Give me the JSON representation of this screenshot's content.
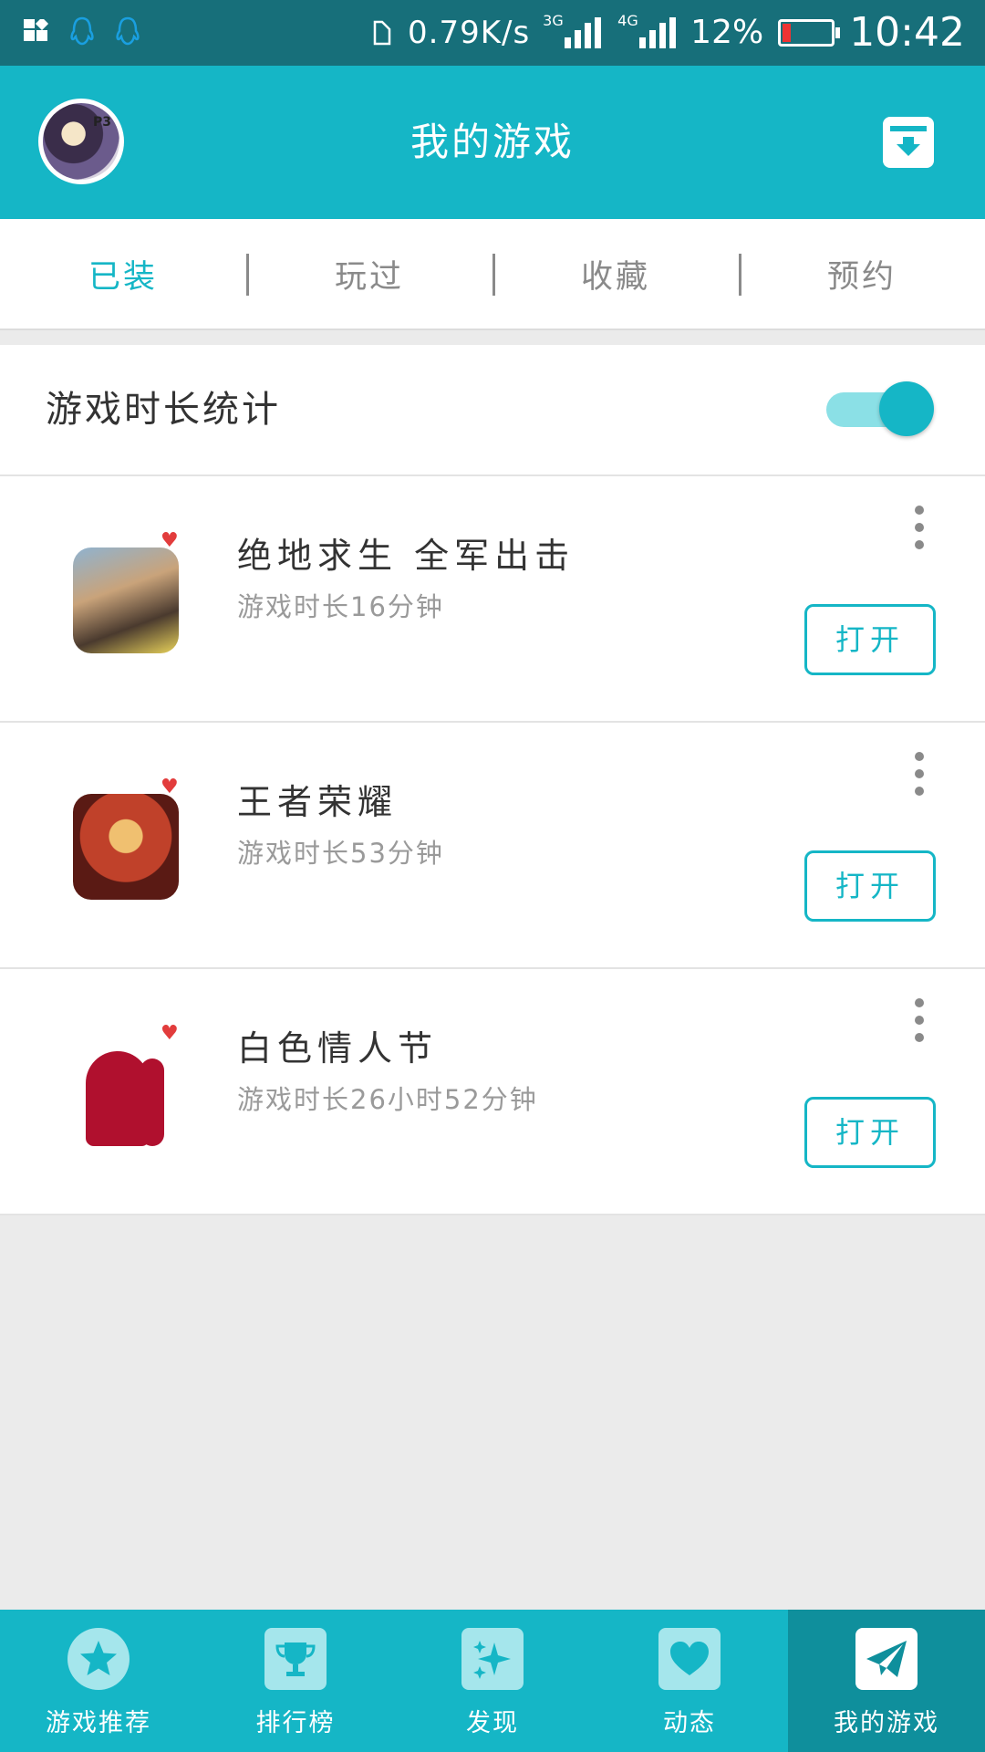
{
  "status_bar": {
    "net_speed": "0.79K/s",
    "sim1_type": "3G",
    "sim2_type": "4G",
    "battery": "12%",
    "time": "10:42"
  },
  "header": {
    "title": "我的游戏",
    "avatar_badge": "P3"
  },
  "tabs": [
    {
      "label": "已装",
      "active": true
    },
    {
      "label": "玩过",
      "active": false
    },
    {
      "label": "收藏",
      "active": false
    },
    {
      "label": "预约",
      "active": false
    }
  ],
  "stats": {
    "label": "游戏时长统计",
    "toggle_on": true
  },
  "games": [
    {
      "name": "绝地求生 全军出击",
      "time": "游戏时长16分钟",
      "open_label": "打开"
    },
    {
      "name": "王者荣耀",
      "time": "游戏时长53分钟",
      "open_label": "打开"
    },
    {
      "name": "白色情人节",
      "time": "游戏时长26小时52分钟",
      "open_label": "打开"
    }
  ],
  "bottom_nav": [
    {
      "label": "游戏推荐",
      "icon": "star-icon",
      "active": false
    },
    {
      "label": "排行榜",
      "icon": "trophy-icon",
      "active": false
    },
    {
      "label": "发现",
      "icon": "sparkle-icon",
      "active": false
    },
    {
      "label": "动态",
      "icon": "heart-icon",
      "active": false
    },
    {
      "label": "我的游戏",
      "icon": "paper-plane-icon",
      "active": true
    }
  ],
  "colors": {
    "accent": "#15b6c6",
    "status_bar": "#176f7a",
    "nav_active": "#0f8f9c"
  }
}
